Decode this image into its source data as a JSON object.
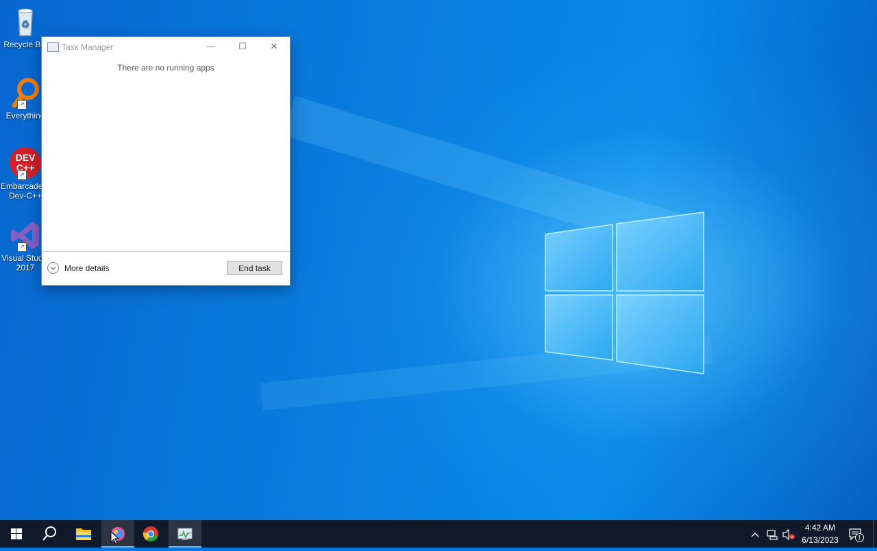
{
  "desktop_icons": [
    {
      "label": "Recycle Bin",
      "icon": "recycle-bin-icon"
    },
    {
      "label": "Everything",
      "icon": "everything-search-icon"
    },
    {
      "label_line1": "Embarcadero",
      "label_line2": "Dev-C++",
      "badge": "DEV C++",
      "icon": "dev-cpp-icon"
    },
    {
      "label_line1": "Visual Studio",
      "label_line2": "2017",
      "icon": "visual-studio-icon"
    }
  ],
  "task_manager": {
    "title": "Task Manager",
    "empty_message": "There are no running apps",
    "more_details_label": "More details",
    "end_task_label": "End task",
    "minimize_glyph": "—",
    "maximize_glyph": "☐",
    "close_glyph": "✕"
  },
  "taskbar": {
    "items": [
      "start-icon",
      "search-icon",
      "file-explorer-icon",
      "paint-3d-icon",
      "chrome-icon",
      "task-manager-icon"
    ],
    "clock": {
      "time": "4:42 AM",
      "date": "6/13/2023"
    },
    "notification_count": "1"
  },
  "colors": {
    "taskbar": "#101a2a",
    "desktop": "#0a78d8",
    "window_border": "#5a8fd0"
  }
}
